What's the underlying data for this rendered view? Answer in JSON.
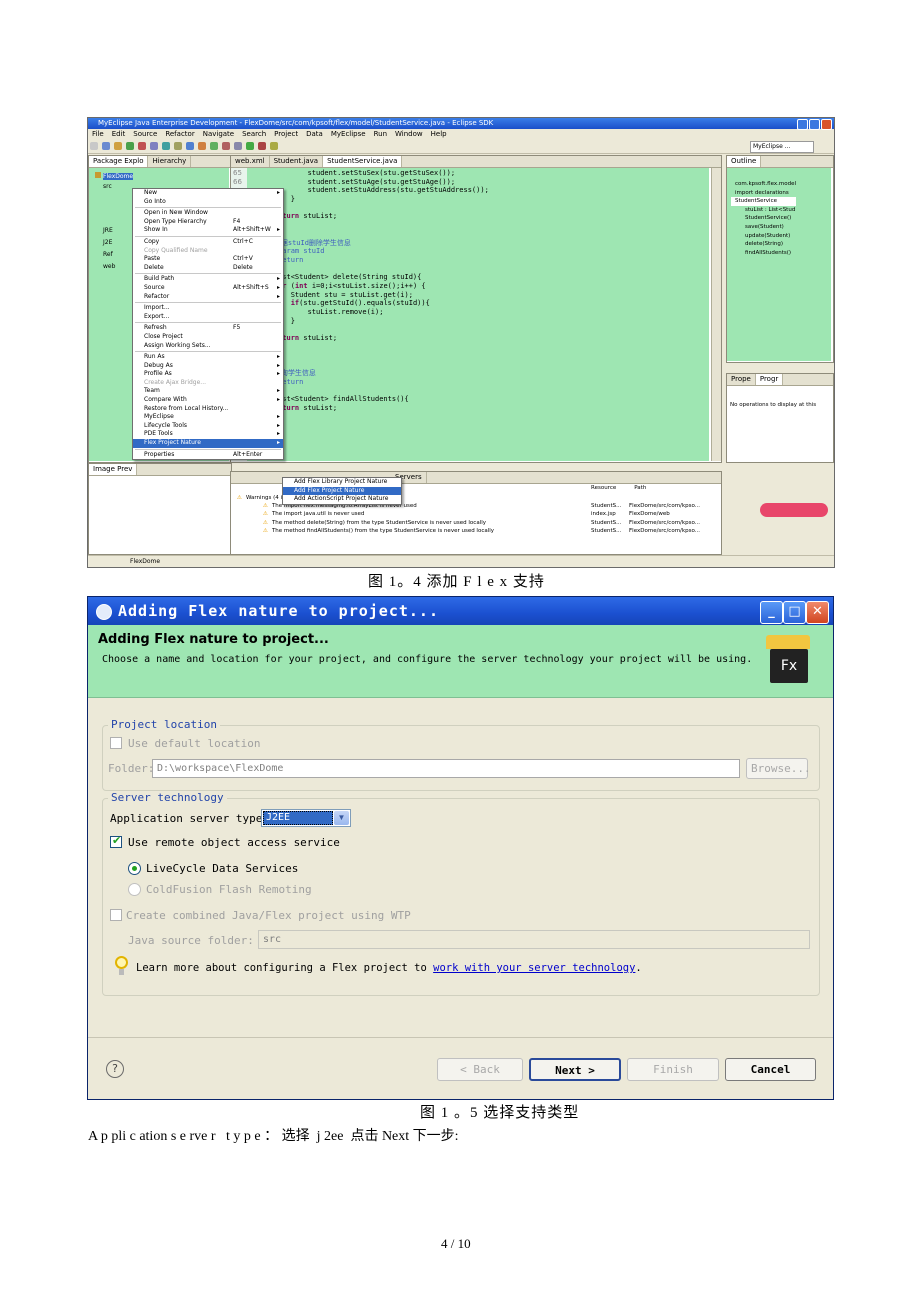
{
  "figure1": {
    "window_title": "MyEclipse Java Enterprise Development - FlexDome/src/com/kpsoft/flex/model/StudentService.java - Eclipse SDK",
    "menubar": [
      "File",
      "Edit",
      "Source",
      "Refactor",
      "Navigate",
      "Search",
      "Project",
      "Data",
      "MyEclipse",
      "Run",
      "Window",
      "Help"
    ],
    "perspective": "MyEclipse ...",
    "left_tabs": [
      "Package Explo",
      "Hierarchy"
    ],
    "tree_root": "FlexDome",
    "tree_items": [
      "src",
      "JRE",
      "J2E",
      "Ref",
      "web"
    ],
    "editor_tabs": [
      "web.xml",
      "Student.java",
      "StudentService.java"
    ],
    "line_numbers": [
      "65",
      "66"
    ],
    "code_lines": [
      "            student.setStuSex(stu.getStuSex());",
      "            student.setStuAge(stu.getStuAge());",
      "            student.setStuAddress(stu.getStuAddress());",
      "        }",
      "    }",
      "    return stuList;",
      "",
      "",
      "    根据stuId删除学生信息",
      "    @param stuId",
      "    @return",
      "",
      "ate List<Student> delete(String stuId){",
      "    for (int i=0;i<stuList.size();i++) {",
      "        Student stu = stuList.get(i);",
      "        if(stu.getStuId().equals(stuId)){",
      "            stuList.remove(i);",
      "        }",
      "    }",
      "    return stuList;",
      "",
      "",
      "",
      "    查询学生信息",
      "    @return",
      "",
      "ate List<Student> findAllStudents(){",
      "    return stuList;"
    ],
    "context_menu": [
      {
        "label": "New",
        "shortcut": "",
        "sub": true
      },
      {
        "label": "Go Into",
        "shortcut": "",
        "sub": false
      },
      {
        "sep": true
      },
      {
        "label": "Open in New Window",
        "shortcut": "",
        "sub": false
      },
      {
        "label": "Open Type Hierarchy",
        "shortcut": "F4",
        "sub": false
      },
      {
        "label": "Show In",
        "shortcut": "Alt+Shift+W",
        "sub": true
      },
      {
        "sep": true
      },
      {
        "label": "Copy",
        "shortcut": "Ctrl+C",
        "sub": false
      },
      {
        "label": "Copy Qualified Name",
        "shortcut": "",
        "sub": false,
        "disabled": true
      },
      {
        "label": "Paste",
        "shortcut": "Ctrl+V",
        "sub": false
      },
      {
        "label": "Delete",
        "shortcut": "Delete",
        "sub": false
      },
      {
        "sep": true
      },
      {
        "label": "Build Path",
        "shortcut": "",
        "sub": true
      },
      {
        "label": "Source",
        "shortcut": "Alt+Shift+S",
        "sub": true
      },
      {
        "label": "Refactor",
        "shortcut": "",
        "sub": true
      },
      {
        "sep": true
      },
      {
        "label": "Import...",
        "shortcut": "",
        "sub": false
      },
      {
        "label": "Export...",
        "shortcut": "",
        "sub": false
      },
      {
        "sep": true
      },
      {
        "label": "Refresh",
        "shortcut": "F5",
        "sub": false
      },
      {
        "label": "Close Project",
        "shortcut": "",
        "sub": false
      },
      {
        "label": "Assign Working Sets...",
        "shortcut": "",
        "sub": false
      },
      {
        "sep": true
      },
      {
        "label": "Run As",
        "shortcut": "",
        "sub": true
      },
      {
        "label": "Debug As",
        "shortcut": "",
        "sub": true
      },
      {
        "label": "Profile As",
        "shortcut": "",
        "sub": true
      },
      {
        "label": "Create Ajax Bridge...",
        "shortcut": "",
        "sub": false,
        "disabled": true
      },
      {
        "label": "Team",
        "shortcut": "",
        "sub": true
      },
      {
        "label": "Compare With",
        "shortcut": "",
        "sub": true
      },
      {
        "label": "Restore from Local History...",
        "shortcut": "",
        "sub": false
      },
      {
        "label": "MyEclipse",
        "shortcut": "",
        "sub": true
      },
      {
        "label": "Lifecycle Tools",
        "shortcut": "",
        "sub": true
      },
      {
        "label": "PDE Tools",
        "shortcut": "",
        "sub": true
      },
      {
        "label": "Flex Project Nature",
        "shortcut": "",
        "sub": true,
        "highlight": true
      },
      {
        "sep": true
      },
      {
        "label": "Properties",
        "shortcut": "Alt+Enter",
        "sub": false
      }
    ],
    "submenu": [
      "Add Flex Library Project Nature",
      "Add Flex Project Nature",
      "Add ActionScript Project Nature"
    ],
    "outline_title": "Outline",
    "outline_items": [
      "com.kpsoft.flex.model",
      "import declarations",
      "StudentService",
      "stuList : List<Stud",
      "StudentService()",
      "save(Student)",
      "update(Student)",
      "delete(String)",
      "findAllStudents()"
    ],
    "props_tabs": [
      "Prope",
      "Progr"
    ],
    "props_msg": "No operations to display at this",
    "bottom_left_tab": "Image Prev",
    "servers_tab": "Servers",
    "problems_header": [
      "Resource",
      "Path"
    ],
    "problems": [
      {
        "desc": "Warnings (4 items)",
        "res": "",
        "path": ""
      },
      {
        "desc": "The import flex.messaging.io.ArrayList is never used",
        "res": "StudentS...",
        "path": "FlexDome/src/com/kpso..."
      },
      {
        "desc": "The import java.util is never used",
        "res": "index.jsp",
        "path": "FlexDome/web"
      },
      {
        "desc": "The method delete(String) from the type StudentService is never used locally",
        "res": "StudentS...",
        "path": "FlexDome/src/com/kpso..."
      },
      {
        "desc": "The method findAllStudents() from the type StudentService is never used locally",
        "res": "StudentS...",
        "path": "FlexDome/src/com/kpso..."
      }
    ],
    "status": "FlexDome"
  },
  "caption1": "图 1。4 添加 F l e x 支持",
  "figure2": {
    "title": "Adding Flex nature to project...",
    "header_title": "Adding Flex nature to project...",
    "header_desc": "Choose a name and location for your project, and configure the server technology your project will be using.",
    "fx_logo": "Fx",
    "project_location_legend": "Project location",
    "use_default_location": "Use default location",
    "folder_label": "Folder:",
    "folder_value": "D:\\workspace\\FlexDome",
    "browse_label": "Browse...",
    "server_tech_legend": "Server technology",
    "app_server_type_label": "Application server type:",
    "app_server_type_value": "J2EE",
    "use_remote_object": "Use remote object access service",
    "lcds_label": "LiveCycle Data Services",
    "cf_label": "ColdFusion Flash Remoting",
    "create_combined": "Create combined Java/Flex project using WTP",
    "java_source_label": "Java source folder:",
    "java_source_value": "src",
    "learn_more_prefix": "Learn more about configuring a Flex project to ",
    "learn_more_link": "work with your server technology",
    "learn_more_suffix": ".",
    "help_glyph": "?",
    "back_label": "< Back",
    "next_label": "Next >",
    "finish_label": "Finish",
    "cancel_label": "Cancel"
  },
  "caption2": "图 1 。5 选择支持类型",
  "body_text": "A p pli c ation s e rve r   t y p e ： 选择  j 2ee  点击 Next 下一步:",
  "page_number": "4 / 10",
  "colors": {
    "dialog_header_green": "#9ee6b2",
    "titlebar_blue": "#1b50d0",
    "menu_highlight": "#316ac5",
    "link_blue": "#0000cc"
  }
}
